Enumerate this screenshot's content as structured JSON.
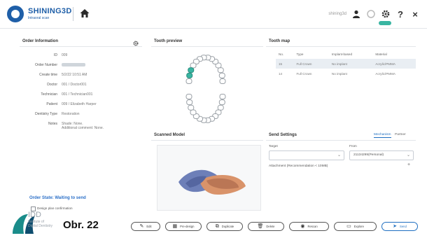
{
  "header": {
    "brand": "SHINING3D",
    "brand_sub": "Intraoral scan",
    "user": "shining3d",
    "icons": [
      "user-icon",
      "gear-icon",
      "help-icon",
      "close-icon"
    ],
    "help": "?",
    "close": "×"
  },
  "order_info": {
    "title": "Order Information",
    "rows": [
      {
        "label": "ID",
        "value": "009"
      },
      {
        "label": "Order Number",
        "value": ""
      },
      {
        "label": "Create time",
        "value": "5/2/22 10:51 AM"
      },
      {
        "label": "Doctor",
        "value": "001 / Doctor001"
      },
      {
        "label": "Technician",
        "value": "001 / Technician001"
      },
      {
        "label": "Patient",
        "value": "009 / Elizabeth Harper"
      },
      {
        "label": "Dentistry Type",
        "value": "Restoration"
      },
      {
        "label": "Notes",
        "value": "Shade: None.\nAdditional comment: None."
      }
    ],
    "order_state": "Order State:  Waiting to send",
    "design_confirm": "Design plan confirmation"
  },
  "tooth_preview": {
    "title": "Tooth preview"
  },
  "tooth_map": {
    "title": "Tooth map",
    "columns": [
      "No.",
      "Type",
      "Implant-based",
      "Material"
    ],
    "rows": [
      [
        "15",
        "Full Crown",
        "No implant",
        "Acrylic/PMMA"
      ],
      [
        "14",
        "Full Crown",
        "No implant",
        "Acrylic/PMMA"
      ]
    ]
  },
  "scanned_model": {
    "title": "Scanned Model"
  },
  "send_settings": {
    "title": "Send Settings",
    "tabs": [
      "Mechanism",
      "Partner"
    ],
    "target_label": "Target",
    "target_value": "",
    "from_label": "From",
    "from_value": "21134299(Personal)",
    "attachment": "Attachment (Recommendation < 10MB)"
  },
  "actions": [
    {
      "icon": "edit-icon",
      "label": "Edit"
    },
    {
      "icon": "pre-design-icon",
      "label": "Pre-design"
    },
    {
      "icon": "duplicate-icon",
      "label": "Duplicate"
    },
    {
      "icon": "delete-icon",
      "label": "Delete"
    },
    {
      "icon": "rescan-icon",
      "label": "Rescan"
    },
    {
      "icon": "explore-icon",
      "label": "Explore"
    },
    {
      "icon": "send-icon",
      "label": "Send"
    }
  ],
  "watermark": {
    "brand": "IDD",
    "sub1": "Institute of",
    "sub2": "Digital Dentistry",
    "figure": "Obr. 22"
  },
  "colors": {
    "accent": "#1f6fc1",
    "brand": "#1f5fa8",
    "status": "#39b5a2"
  }
}
